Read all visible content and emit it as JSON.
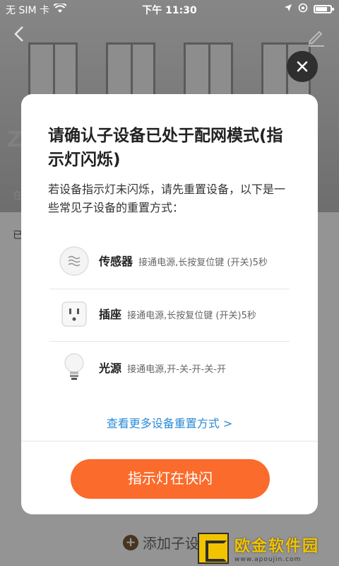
{
  "status_bar": {
    "carrier": "无 SIM 卡",
    "time": "下午 11:30"
  },
  "background": {
    "side_text_1": "Z",
    "side_text_2": "在",
    "side_text_3": "已",
    "add_sub_label": "添加子设"
  },
  "modal": {
    "title": "请确认子设备已处于配网模式(指示灯闪烁)",
    "description": "若设备指示灯未闪烁，请先重置设备，以下是一些常见子设备的重置方式：",
    "devices": [
      {
        "name": "传感器",
        "instruction": "接通电源,长按复位键 (开关)5秒",
        "icon": "sensor-icon"
      },
      {
        "name": "插座",
        "instruction": "接通电源,长按复位键 (开关)5秒",
        "icon": "socket-icon"
      },
      {
        "name": "光源",
        "instruction": "接通电源,开-关-开-关-开",
        "icon": "bulb-icon"
      }
    ],
    "more_link": "查看更多设备重置方式 >",
    "confirm_button": "指示灯在快闪"
  },
  "watermark": {
    "title": "欧金软件园",
    "url": "www.apoujin.com"
  },
  "colors": {
    "accent": "#fa6b2c",
    "link": "#2a8bd8",
    "overlay": "rgba(0,0,0,0.42)"
  }
}
